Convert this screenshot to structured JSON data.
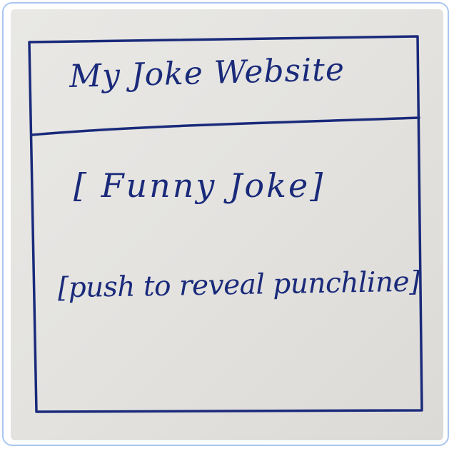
{
  "header": {
    "title": "My Joke Website"
  },
  "main": {
    "joke_placeholder": "[ Funny Joke]",
    "reveal_button_label": "[push to reveal punchline]"
  },
  "colors": {
    "ink": "#1a2a7a",
    "paper": "#e6e5e2",
    "frame_border": "#a9c7f0"
  }
}
